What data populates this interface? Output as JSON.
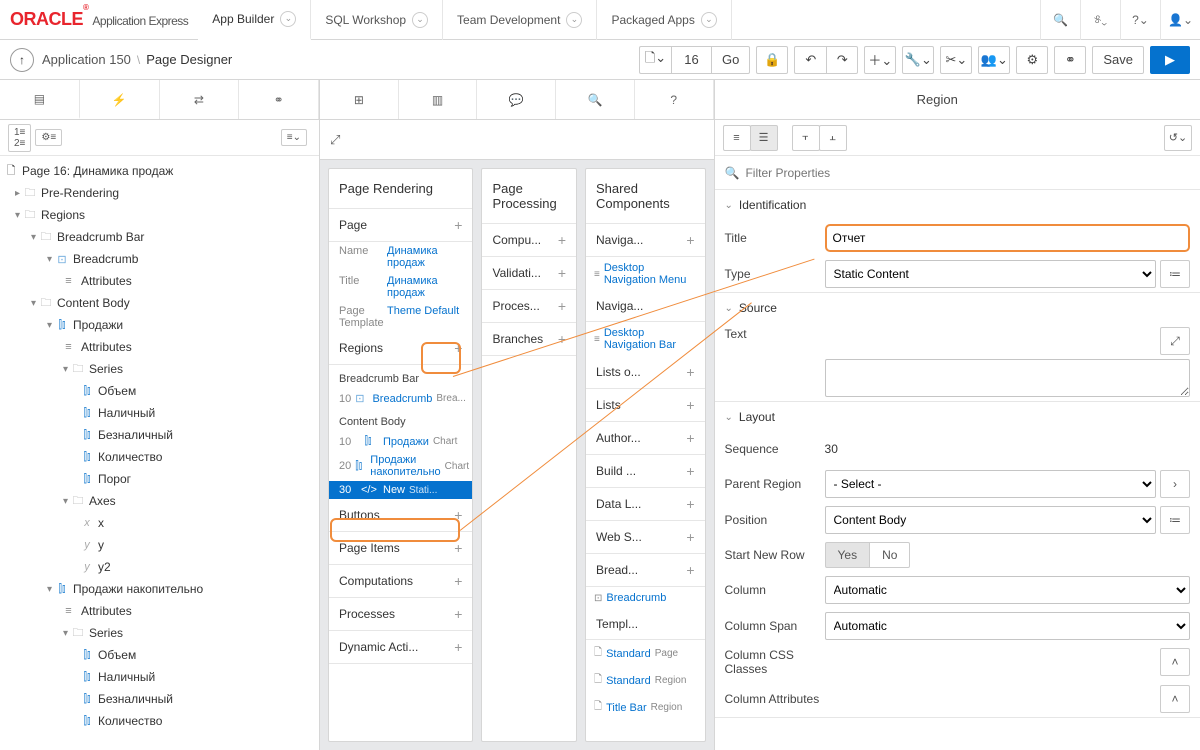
{
  "brand": {
    "name": "ORACLE",
    "suffix": "Application Express"
  },
  "topnav": [
    "App Builder",
    "SQL Workshop",
    "Team Development",
    "Packaged Apps"
  ],
  "breadcrumb": {
    "app": "Application 150",
    "page": "Page Designer"
  },
  "page_number": "16",
  "go": "Go",
  "save": "Save",
  "tree": {
    "page_title": "Page 16: Динамика продаж",
    "pre_rendering": "Pre-Rendering",
    "regions": "Regions",
    "breadcrumb_bar": "Breadcrumb Bar",
    "breadcrumb": "Breadcrumb",
    "attributes": "Attributes",
    "content_body": "Content Body",
    "chart1": "Продажи",
    "series": "Series",
    "series_items1": [
      "Объем",
      "Наличный",
      "Безналичный",
      "Количество",
      "Порог"
    ],
    "axes": "Axes",
    "axes_items": [
      "x",
      "y",
      "y2"
    ],
    "chart2": "Продажи накопительно",
    "series_items2": [
      "Объем",
      "Наличный",
      "Безналичный",
      "Количество"
    ]
  },
  "rendering": {
    "title": "Page Rendering",
    "page_section": "Page",
    "name_k": "Name",
    "name_v": "Динамика продаж",
    "title_k": "Title",
    "title_v": "Динамика продаж",
    "tmpl_k": "Page Template",
    "tmpl_v": "Theme Default",
    "regions": "Regions",
    "bc_bar": "Breadcrumb Bar",
    "bc_row": {
      "seq": "10",
      "name": "Breadcrumb",
      "type": "Brea..."
    },
    "cb": "Content Body",
    "cb_rows": [
      {
        "seq": "10",
        "name": "Продажи",
        "type": "Chart"
      },
      {
        "seq": "20",
        "name": "Продажи накопительно",
        "type": "Chart"
      },
      {
        "seq": "30",
        "name": "New",
        "type": "Stati...",
        "selected": true
      }
    ],
    "buttons": "Buttons",
    "page_items": "Page Items",
    "computations": "Computations",
    "processes": "Processes",
    "dynamic": "Dynamic Acti..."
  },
  "processing": {
    "title": "Page Processing",
    "items": [
      "Compu...",
      "Validati...",
      "Proces...",
      "Branches"
    ]
  },
  "shared": {
    "title": "Shared Components",
    "nav_menu": "Naviga...",
    "dnm": "Desktop Navigation Menu",
    "nav_bar": "Naviga...",
    "dnb": "Desktop Navigation Bar",
    "lists_o": "Lists o...",
    "lists": "Lists",
    "author": "Author...",
    "build": "Build ...",
    "data_l": "Data L...",
    "web_s": "Web S...",
    "bread": "Bread...",
    "bc": "Breadcrumb",
    "templ": "Templ...",
    "t_rows": [
      {
        "name": "Standard",
        "type": "Page"
      },
      {
        "name": "Standard",
        "type": "Region"
      },
      {
        "name": "Title Bar",
        "type": "Region"
      }
    ]
  },
  "panel": {
    "title": "Region",
    "filter_ph": "Filter Properties",
    "sec_ident": "Identification",
    "lbl_title": "Title",
    "val_title": "Отчет",
    "lbl_type": "Type",
    "val_type": "Static Content",
    "sec_source": "Source",
    "lbl_text": "Text",
    "sec_layout": "Layout",
    "lbl_seq": "Sequence",
    "val_seq": "30",
    "lbl_parent": "Parent Region",
    "val_parent": "- Select -",
    "lbl_pos": "Position",
    "val_pos": "Content Body",
    "lbl_snr": "Start New Row",
    "yes": "Yes",
    "no": "No",
    "lbl_col": "Column",
    "val_col": "Automatic",
    "lbl_span": "Column Span",
    "val_span": "Automatic",
    "lbl_css": "Column CSS Classes",
    "lbl_colattr": "Column Attributes"
  }
}
